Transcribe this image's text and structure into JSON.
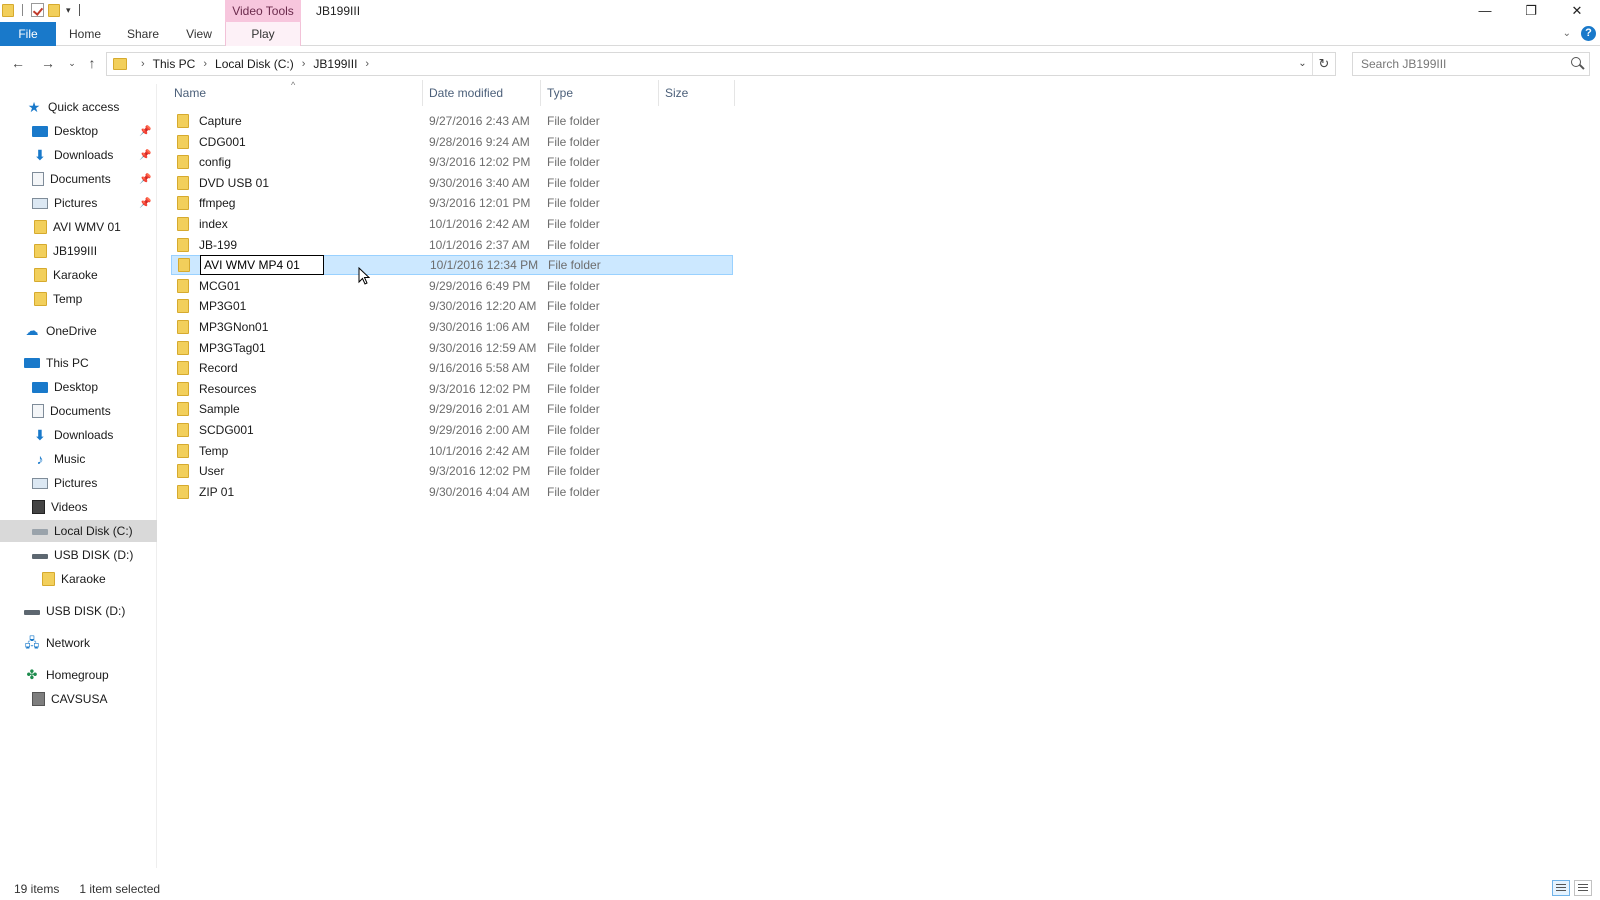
{
  "titlebar": {
    "context_tab_header": "Video Tools",
    "window_title": "JB199III",
    "minimize_glyph": "—",
    "maximize_glyph": "❐",
    "close_glyph": "✕"
  },
  "ribbon": {
    "tabs": [
      "File",
      "Home",
      "Share",
      "View",
      "Play"
    ],
    "help_glyph": "?",
    "expand_glyph": "⌄"
  },
  "address": {
    "crumbs": [
      "This PC",
      "Local Disk (C:)",
      "JB199III"
    ],
    "search_placeholder": "Search JB199III"
  },
  "navigation": {
    "quick_access": {
      "label": "Quick access",
      "items": [
        {
          "label": "Desktop",
          "icon": "desktop-icon",
          "pinned": true
        },
        {
          "label": "Downloads",
          "icon": "downloads-icon",
          "pinned": true
        },
        {
          "label": "Documents",
          "icon": "documents-icon",
          "pinned": true
        },
        {
          "label": "Pictures",
          "icon": "pictures-icon",
          "pinned": true
        },
        {
          "label": "AVI WMV 01",
          "icon": "folder-icon",
          "pinned": false
        },
        {
          "label": "JB199III",
          "icon": "folder-icon",
          "pinned": false
        },
        {
          "label": "Karaoke",
          "icon": "folder-icon",
          "pinned": false
        },
        {
          "label": "Temp",
          "icon": "folder-icon",
          "pinned": false
        }
      ]
    },
    "onedrive": "OneDrive",
    "this_pc": {
      "label": "This PC",
      "items": [
        {
          "label": "Desktop",
          "icon": "desktop-icon"
        },
        {
          "label": "Documents",
          "icon": "documents-icon"
        },
        {
          "label": "Downloads",
          "icon": "downloads-icon"
        },
        {
          "label": "Music",
          "icon": "music-icon"
        },
        {
          "label": "Pictures",
          "icon": "pictures-icon"
        },
        {
          "label": "Videos",
          "icon": "videos-icon"
        },
        {
          "label": "Local Disk (C:)",
          "icon": "local-disk-icon",
          "selected": true
        },
        {
          "label": "USB DISK (D:)",
          "icon": "usb-disk-icon"
        },
        {
          "label": "Karaoke",
          "icon": "folder-icon"
        }
      ]
    },
    "usb_disk": "USB DISK (D:)",
    "network": "Network",
    "homegroup": "Homegroup",
    "homegroup_user": "CAVSUSA"
  },
  "filelist": {
    "columns": [
      "Name",
      "Date modified",
      "Type",
      "Size"
    ],
    "rows": [
      {
        "name": "Capture",
        "date": "9/27/2016 2:43 AM",
        "type": "File folder"
      },
      {
        "name": "CDG001",
        "date": "9/28/2016 9:24 AM",
        "type": "File folder"
      },
      {
        "name": "config",
        "date": "9/3/2016 12:02 PM",
        "type": "File folder"
      },
      {
        "name": "DVD USB 01",
        "date": "9/30/2016 3:40 AM",
        "type": "File folder"
      },
      {
        "name": "ffmpeg",
        "date": "9/3/2016 12:01 PM",
        "type": "File folder"
      },
      {
        "name": "index",
        "date": "10/1/2016 2:42 AM",
        "type": "File folder"
      },
      {
        "name": "JB-199",
        "date": "10/1/2016 2:37 AM",
        "type": "File folder"
      },
      {
        "name": "AVI WMV MP4 01",
        "date": "10/1/2016 12:34 PM",
        "type": "File folder",
        "selected": true,
        "renaming": true
      },
      {
        "name": "MCG01",
        "date": "9/29/2016 6:49 PM",
        "type": "File folder"
      },
      {
        "name": "MP3G01",
        "date": "9/30/2016 12:20 AM",
        "type": "File folder"
      },
      {
        "name": "MP3GNon01",
        "date": "9/30/2016 1:06 AM",
        "type": "File folder"
      },
      {
        "name": "MP3GTag01",
        "date": "9/30/2016 12:59 AM",
        "type": "File folder"
      },
      {
        "name": "Record",
        "date": "9/16/2016 5:58 AM",
        "type": "File folder"
      },
      {
        "name": "Resources",
        "date": "9/3/2016 12:02 PM",
        "type": "File folder"
      },
      {
        "name": "Sample",
        "date": "9/29/2016 2:01 AM",
        "type": "File folder"
      },
      {
        "name": "SCDG001",
        "date": "9/29/2016 2:00 AM",
        "type": "File folder"
      },
      {
        "name": "Temp",
        "date": "10/1/2016 2:42 AM",
        "type": "File folder"
      },
      {
        "name": "User",
        "date": "9/3/2016 12:02 PM",
        "type": "File folder"
      },
      {
        "name": "ZIP 01",
        "date": "9/30/2016 4:04 AM",
        "type": "File folder"
      }
    ]
  },
  "status": {
    "item_count": "19 items",
    "selection": "1 item selected"
  },
  "colors": {
    "accent": "#1979ca",
    "selection": "#cce8ff",
    "context_tab": "#f7c6dd",
    "folder": "#f2cf5b"
  }
}
